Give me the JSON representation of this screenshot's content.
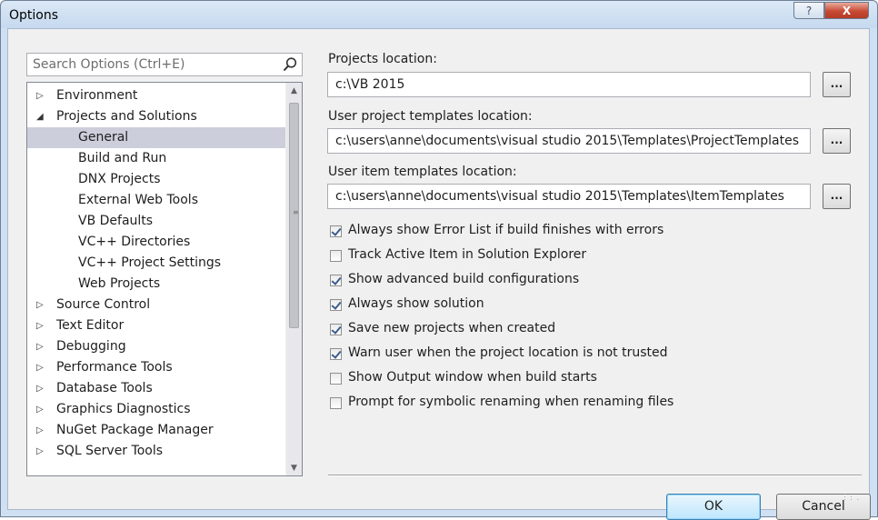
{
  "window": {
    "title": "Options",
    "help_label": "?",
    "close_label": "X"
  },
  "search": {
    "placeholder": "Search Options (Ctrl+E)",
    "icon": "search-icon"
  },
  "tree": {
    "items": [
      {
        "label": "Environment",
        "level": 0,
        "expanded": false
      },
      {
        "label": "Projects and Solutions",
        "level": 0,
        "expanded": true
      },
      {
        "label": "General",
        "level": 1,
        "selected": true
      },
      {
        "label": "Build and Run",
        "level": 1
      },
      {
        "label": "DNX Projects",
        "level": 1
      },
      {
        "label": "External Web Tools",
        "level": 1
      },
      {
        "label": "VB Defaults",
        "level": 1
      },
      {
        "label": "VC++ Directories",
        "level": 1
      },
      {
        "label": "VC++ Project Settings",
        "level": 1
      },
      {
        "label": "Web Projects",
        "level": 1
      },
      {
        "label": "Source Control",
        "level": 0,
        "expanded": false
      },
      {
        "label": "Text Editor",
        "level": 0,
        "expanded": false
      },
      {
        "label": "Debugging",
        "level": 0,
        "expanded": false
      },
      {
        "label": "Performance Tools",
        "level": 0,
        "expanded": false
      },
      {
        "label": "Database Tools",
        "level": 0,
        "expanded": false
      },
      {
        "label": "Graphics Diagnostics",
        "level": 0,
        "expanded": false
      },
      {
        "label": "NuGet Package Manager",
        "level": 0,
        "expanded": false
      },
      {
        "label": "SQL Server Tools",
        "level": 0,
        "expanded": false
      }
    ]
  },
  "fields": {
    "projects_location": {
      "label": "Projects location:",
      "value": "c:\\VB 2015"
    },
    "project_templates": {
      "label": "User project templates location:",
      "value": "c:\\users\\anne\\documents\\visual studio 2015\\Templates\\ProjectTemplates"
    },
    "item_templates": {
      "label": "User item templates location:",
      "value": "c:\\users\\anne\\documents\\visual studio 2015\\Templates\\ItemTemplates"
    },
    "browse_label": "..."
  },
  "checkboxes": [
    {
      "label": "Always show Error List if build finishes with errors",
      "checked": true
    },
    {
      "label": "Track Active Item in Solution Explorer",
      "checked": false
    },
    {
      "label": "Show advanced build configurations",
      "checked": true
    },
    {
      "label": "Always show solution",
      "checked": true
    },
    {
      "label": "Save new projects when created",
      "checked": true
    },
    {
      "label": "Warn user when the project location is not trusted",
      "checked": true
    },
    {
      "label": "Show Output window when build starts",
      "checked": false
    },
    {
      "label": "Prompt for symbolic renaming when renaming files",
      "checked": false
    }
  ],
  "buttons": {
    "ok": "OK",
    "cancel": "Cancel"
  }
}
